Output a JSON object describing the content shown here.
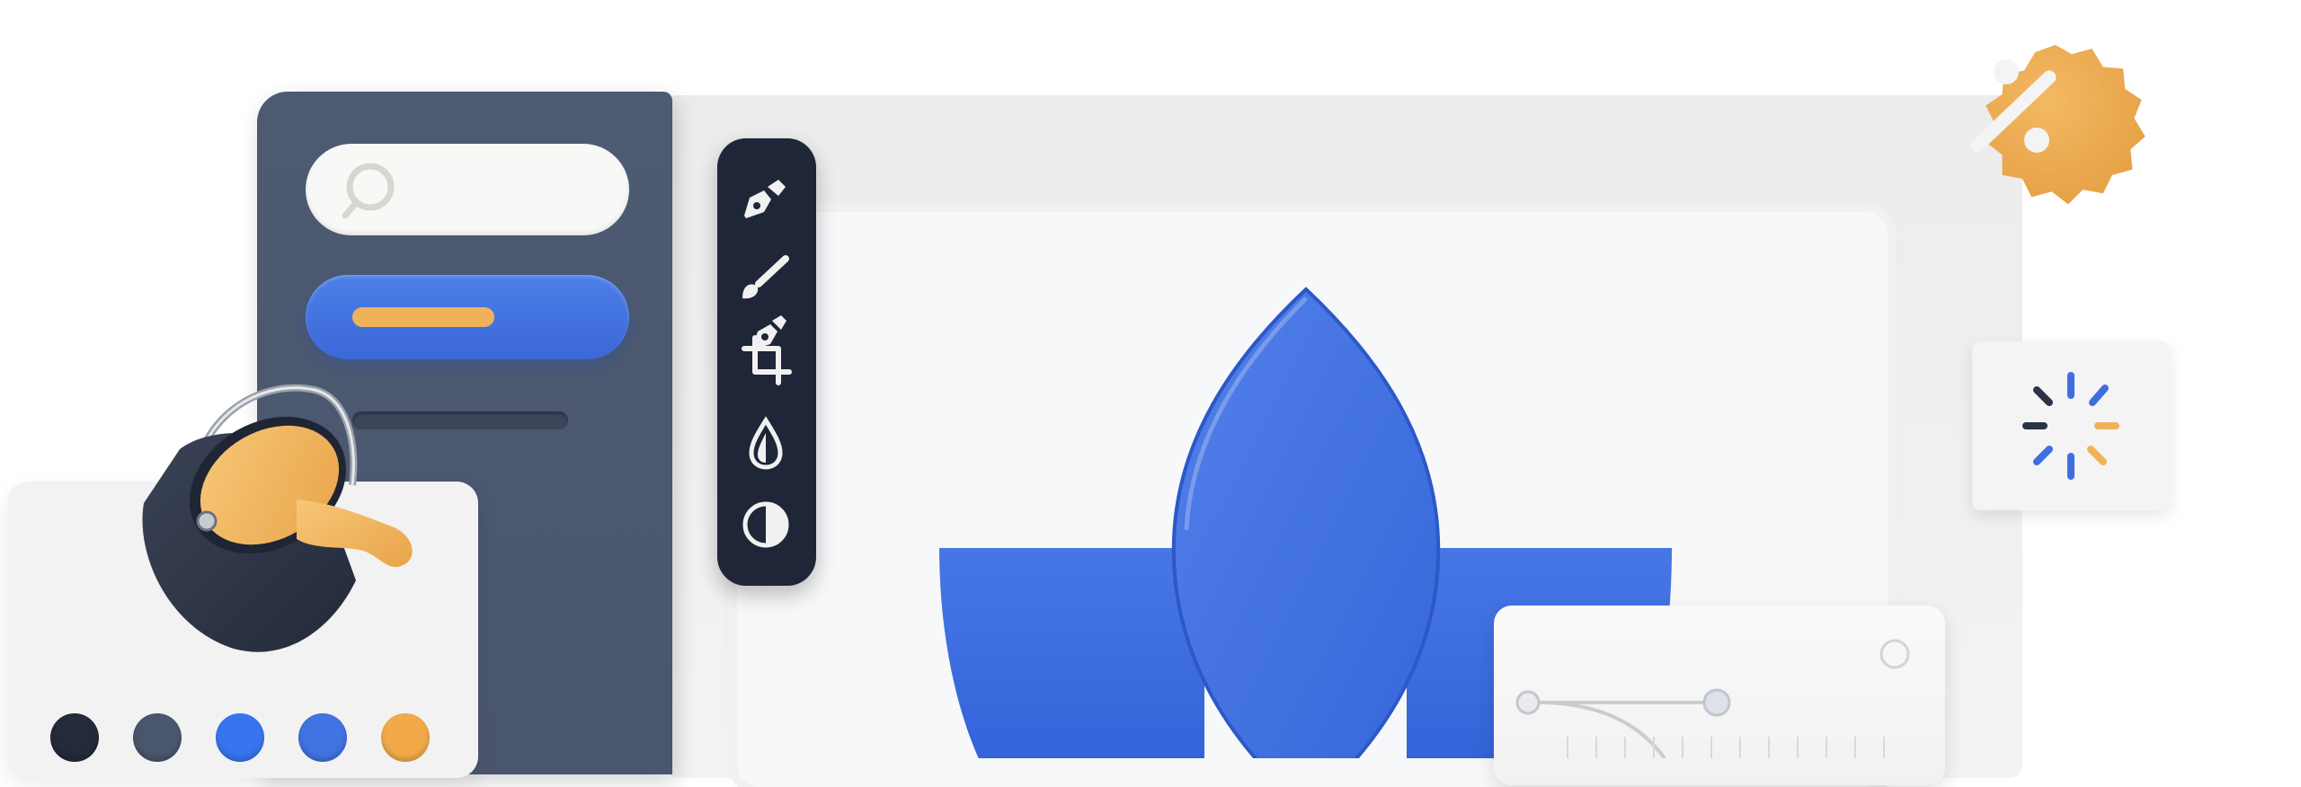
{
  "colors": {
    "background": "#ffffff",
    "sidebar": "#4d5a72",
    "toolbar": "#1f2638",
    "primary_blue": "#3f6ee0",
    "accent_orange": "#f0b259",
    "canvas": "#eeeeee",
    "artboard": "#f7f8fa"
  },
  "sidebar": {
    "search_icon": "search-icon",
    "primary_button_icon": "pill-bar"
  },
  "toolbar": {
    "tools": [
      {
        "name": "pen-tool",
        "icon": "pen-nib-icon"
      },
      {
        "name": "brush-tool",
        "icon": "paintbrush-icon"
      },
      {
        "name": "crop-tool",
        "icon": "crop-icon"
      },
      {
        "name": "drop-tool",
        "icon": "water-drop-icon"
      },
      {
        "name": "contrast-tool",
        "icon": "half-circle-contrast-icon"
      }
    ]
  },
  "swatches": [
    "#242a39",
    "#4a566d",
    "#3775ee",
    "#4173e2",
    "#f2aa48"
  ],
  "badge": {
    "icon": "percent-icon",
    "color": "#eeaa4d"
  },
  "spinner": {
    "icon": "loading-spinner-icon",
    "colors": [
      "#3f6ee0",
      "#f0b259",
      "#2b3447"
    ]
  },
  "artwork": {
    "icon": "lotus-shape-icon",
    "color": "#3f6ee0"
  },
  "paint_bucket": {
    "icon": "paint-bucket-icon",
    "paint_color": "#f2b65c"
  },
  "curve_editor": {
    "icon": "bezier-curve-icon"
  }
}
